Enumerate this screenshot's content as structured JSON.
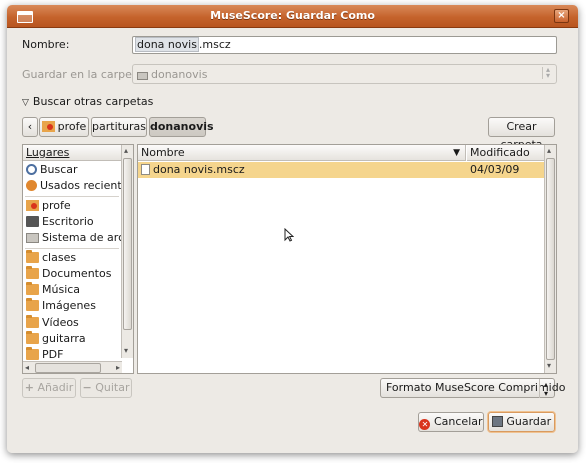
{
  "window": {
    "title": "MuseScore: Guardar Como"
  },
  "name_row": {
    "label": "Nombre:",
    "value_selected": "dona novis",
    "value_rest": ".mscz"
  },
  "folder_row": {
    "label": "Guardar en la carpeta:",
    "value": "donanovis"
  },
  "browse": {
    "label": "Buscar otras carpetas"
  },
  "pathbar": {
    "items": [
      "profe",
      "partituras",
      "donanovis"
    ],
    "active": "donanovis",
    "create_folder": "Crear carpeta"
  },
  "places": {
    "header": "Lugares",
    "items": [
      {
        "label": "Buscar",
        "icon": "search-icon"
      },
      {
        "label": "Usados recientem",
        "icon": "recent-icon"
      },
      {
        "label": "profe",
        "icon": "home-folder-icon"
      },
      {
        "label": "Escritorio",
        "icon": "desktop-icon"
      },
      {
        "label": "Sistema de archivo",
        "icon": "disk-icon"
      },
      {
        "label": "clases",
        "icon": "folder-icon"
      },
      {
        "label": "Documentos",
        "icon": "folder-icon"
      },
      {
        "label": "Música",
        "icon": "folder-icon"
      },
      {
        "label": "Imágenes",
        "icon": "folder-icon"
      },
      {
        "label": "Vídeos",
        "icon": "folder-icon"
      },
      {
        "label": "guitarra",
        "icon": "folder-icon"
      },
      {
        "label": "PDF",
        "icon": "folder-icon"
      }
    ],
    "add_label": "Añadir",
    "remove_label": "Quitar"
  },
  "files": {
    "col_name": "Nombre",
    "col_modified": "Modificado",
    "rows": [
      {
        "name": "dona novis.mscz",
        "modified": "04/03/09",
        "selected": true
      }
    ]
  },
  "filter": {
    "value": "Formato MuseScore Comprimido"
  },
  "actions": {
    "cancel": "Cancelar",
    "save": "Guardar"
  },
  "colors": {
    "titlebar": "#c5632c",
    "selection": "#f5d58d",
    "window_bg": "#edeae5"
  }
}
